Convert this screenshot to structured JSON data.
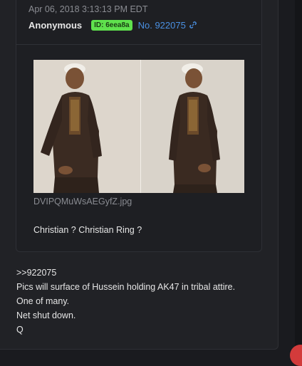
{
  "quoted_post": {
    "date": "Apr 06, 2018 3:13:13 PM EDT",
    "author": "Anonymous",
    "id_badge": "ID: 6eea8a",
    "post_number": "No. 922075",
    "image_filename": "DVIPQMuWsAEGyfZ.jpg",
    "caption": "Christian ? Christian Ring ?"
  },
  "reply": {
    "quote_ref": ">>922075",
    "lines": [
      "Pics will surface of Hussein holding AK47 in tribal attire.",
      "One of many.",
      "Net shut down.",
      "Q"
    ]
  },
  "icons": {
    "post_link": "link-icon",
    "notification": "notification-dot"
  },
  "colors": {
    "background": "#1a1b1f",
    "panel": "#212226",
    "id_badge": "#5fe14d",
    "link": "#4a90e2",
    "notification": "#d33b3b"
  }
}
